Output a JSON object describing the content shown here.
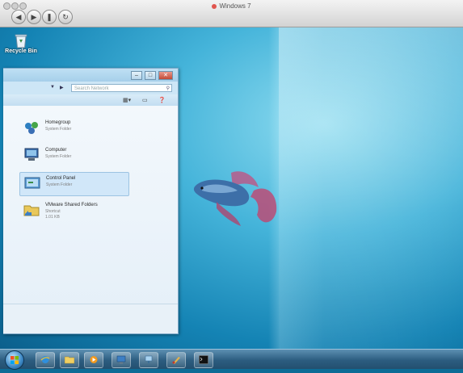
{
  "host_window": {
    "title": "Windows 7",
    "nav_buttons": [
      "back-button",
      "forward-button",
      "reload-button"
    ]
  },
  "desktop": {
    "icons": [
      {
        "label": "Recycle Bin",
        "icon": "recycle-bin-icon"
      }
    ],
    "wallpaper": "betta-fish-blue"
  },
  "explorer": {
    "search_placeholder": "Search Network",
    "address_arrows": [
      "▼",
      "▶"
    ],
    "toolbar_icons": [
      "view-icon",
      "preview-pane-icon",
      "help-icon"
    ],
    "items": [
      {
        "name": "Homegroup",
        "subtitle": "System Folder",
        "extra": "",
        "icon": "homegroup-icon",
        "selected": false
      },
      {
        "name": "Computer",
        "subtitle": "System Folder",
        "extra": "",
        "icon": "computer-icon",
        "selected": false
      },
      {
        "name": "Control Panel",
        "subtitle": "System Folder",
        "extra": "",
        "icon": "control-panel-icon",
        "selected": true
      },
      {
        "name": "VMware Shared Folders",
        "subtitle": "Shortcut",
        "extra": "1.01 KB",
        "icon": "shared-folders-icon",
        "selected": false
      }
    ]
  },
  "taskbar": {
    "items": [
      "start-orb",
      "ie-icon",
      "folder-icon",
      "media-player-icon",
      "remote-desktop-icon",
      "network-icon",
      "paint-icon",
      "cmd-icon"
    ]
  },
  "colors": {
    "desktop_blue": "#1483b4",
    "taskbar": "#2c5d80",
    "close_red": "#c24a36"
  }
}
